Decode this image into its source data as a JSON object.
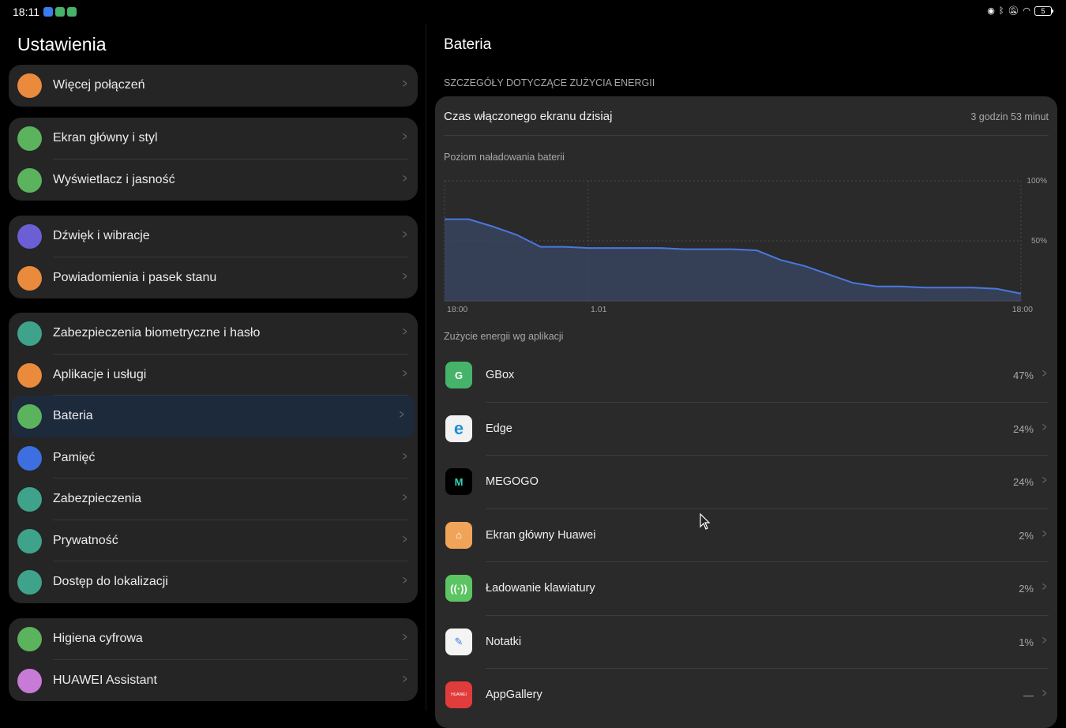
{
  "status_bar": {
    "time": "18:11",
    "notification_icons": [
      "messenger-icon",
      "gbox-icon",
      "gbox-icon"
    ],
    "system_icons": [
      "nfc-icon",
      "bluetooth-icon",
      "mute-icon",
      "wifi-icon"
    ],
    "battery_level": "5"
  },
  "left": {
    "title": "Ustawienia",
    "groups": [
      [
        {
          "label": "Więcej połączeń",
          "icon": "link-icon",
          "color": "#e98a3d"
        }
      ],
      [
        {
          "label": "Ekran główny i styl",
          "icon": "image-icon",
          "color": "#5bb35d"
        },
        {
          "label": "Wyświetlacz i jasność",
          "icon": "eye-icon",
          "color": "#5bb35d"
        }
      ],
      [
        {
          "label": "Dźwięk i wibracje",
          "icon": "speaker-icon",
          "color": "#6c5fd6"
        },
        {
          "label": "Powiadomienia i pasek stanu",
          "icon": "bell-icon",
          "color": "#e98a3d"
        }
      ],
      [
        {
          "label": "Zabezpieczenia biometryczne i hasło",
          "icon": "key-icon",
          "color": "#3fa38c"
        },
        {
          "label": "Aplikacje i usługi",
          "icon": "apps-icon",
          "color": "#e98a3d"
        },
        {
          "label": "Bateria",
          "icon": "battery-icon",
          "color": "#5bb35d",
          "active": true
        },
        {
          "label": "Pamięć",
          "icon": "storage-icon",
          "color": "#3d6fe0"
        },
        {
          "label": "Zabezpieczenia",
          "icon": "shield-icon",
          "color": "#3fa38c"
        },
        {
          "label": "Prywatność",
          "icon": "privacy-icon",
          "color": "#3fa38c"
        },
        {
          "label": "Dostęp do lokalizacji",
          "icon": "location-icon",
          "color": "#3fa38c"
        }
      ],
      [
        {
          "label": "Higiena cyfrowa",
          "icon": "hourglass-icon",
          "color": "#5bb35d"
        },
        {
          "label": "HUAWEI Assistant",
          "icon": "assistant-icon",
          "color": "#c77ad6"
        }
      ]
    ]
  },
  "right": {
    "title": "Bateria",
    "section_header": "SZCZEGÓŁY DOTYCZĄCE ZUŻYCIA ENERGII",
    "screen_time_label": "Czas włączonego ekranu dzisiaj",
    "screen_time_value": "3 godzin 53 minut",
    "chart_title": "Poziom naładowania baterii",
    "apps_title": "Zużycie energii wg aplikacji",
    "apps": [
      {
        "name": "GBox",
        "percent": "47%",
        "icon": "gbox-icon",
        "color": "#46b36a",
        "glyph": "G"
      },
      {
        "name": "Edge",
        "percent": "24%",
        "icon": "edge-icon",
        "color": "#f2f2f2",
        "glyph": "e"
      },
      {
        "name": "MEGOGO",
        "percent": "24%",
        "icon": "megogo-icon",
        "color": "#000000",
        "glyph": "M"
      },
      {
        "name": "Ekran główny Huawei",
        "percent": "2%",
        "icon": "home-icon",
        "color": "#f0a45a",
        "glyph": "⌂"
      },
      {
        "name": "Ładowanie klawiatury",
        "percent": "2%",
        "icon": "wireless-charge-icon",
        "color": "#5cc463",
        "glyph": "((·))"
      },
      {
        "name": "Notatki",
        "percent": "1%",
        "icon": "notes-icon",
        "color": "#f4f4f4",
        "glyph": "✎"
      },
      {
        "name": "AppGallery",
        "percent": "—",
        "icon": "appgallery-icon",
        "color": "#e03c3c",
        "glyph": "HUAWEI"
      }
    ]
  },
  "chart_data": {
    "type": "area",
    "title": "Poziom naładowania baterii",
    "x_ticks": [
      "18:00",
      "1.01",
      "18:00"
    ],
    "y_ticks": [
      "100%",
      "50%"
    ],
    "ylim": [
      0,
      100
    ],
    "x": [
      0,
      1,
      2,
      3,
      4,
      5,
      6,
      7,
      8,
      9,
      10,
      11,
      12,
      13,
      14,
      15,
      16,
      17,
      18,
      19,
      20,
      21,
      22,
      23,
      24
    ],
    "values": [
      68,
      68,
      62,
      55,
      45,
      45,
      44,
      44,
      44,
      44,
      43,
      43,
      43,
      42,
      34,
      29,
      22,
      15,
      12,
      12,
      11,
      11,
      11,
      10,
      6
    ],
    "grid": true,
    "color": "#4a78e0"
  }
}
